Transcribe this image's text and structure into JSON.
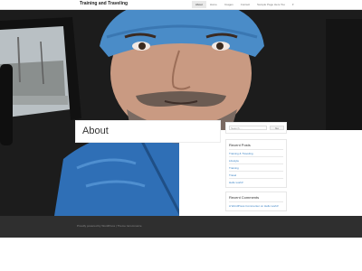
{
  "site": {
    "title": "Training and Traveling"
  },
  "nav": {
    "items": [
      "About",
      "Home",
      "Images",
      "Contact",
      "Sample Page Here Too"
    ],
    "active": "About",
    "dropdown_glyph": "▾"
  },
  "page": {
    "title": "About"
  },
  "search": {
    "placeholder": "Search ...",
    "button_label": "Go"
  },
  "recent_posts": {
    "title": "Recent Posts",
    "items": [
      "Training & Traveling",
      "Lifestyle",
      "Training",
      "Travel",
      "Hello world!"
    ]
  },
  "recent_comments": {
    "title": "Recent Comments",
    "items": [
      "A WordPress Commenter on Hello world!"
    ]
  },
  "footer": {
    "text": "Proudly powered by WordPress | Theme: Ecommerce"
  },
  "colors": {
    "link": "#3a82c4",
    "footer_bg": "#2f2f2f",
    "jacket": "#2f6fb6",
    "beanie": "#4a8cc8"
  },
  "icons": {
    "dropdown": "chevron-down-icon"
  }
}
